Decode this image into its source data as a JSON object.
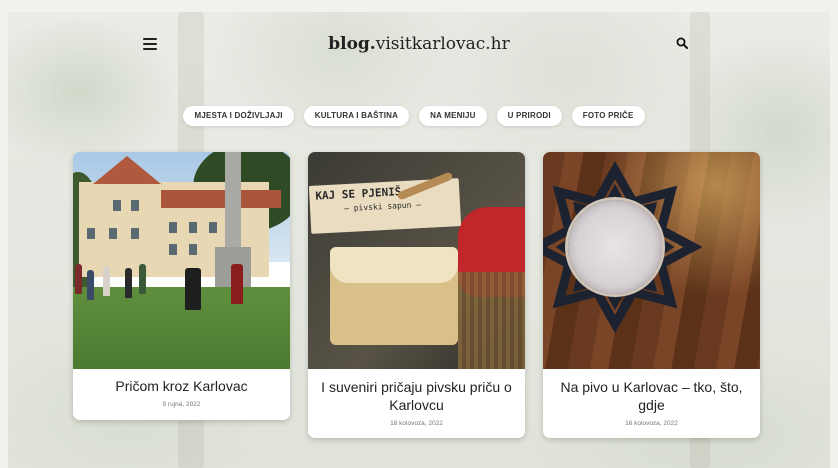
{
  "header": {
    "logo_bold": "blog.",
    "logo_rest": "visitkarlovac.hr",
    "menu_icon": "hamburger-menu-icon",
    "search_icon": "search-icon"
  },
  "categories": [
    {
      "label": "MJESTA I DOŽIVLJAJI"
    },
    {
      "label": "KULTURA I BAŠTINA"
    },
    {
      "label": "NA MENIJU"
    },
    {
      "label": "U PRIRODI"
    },
    {
      "label": "FOTO PRIČE"
    }
  ],
  "posts": [
    {
      "title": "Pričom kroz Karlovac",
      "date": "9 rujna, 2022"
    },
    {
      "title": "I suveniri pričaju pivsku priču o Karlovcu",
      "date": "18 kolovoza, 2022"
    },
    {
      "title": "Na pivo u Karlovac – tko, što, gdje",
      "date": "16 kolovoza, 2022"
    }
  ],
  "images": {
    "post1_sign_text": "",
    "post2_label_line1": "KAJ SE PJENIŠ",
    "post2_label_line2": "– pivski sapun –"
  },
  "colors": {
    "background": "#f2f1ed",
    "card": "#ffffff",
    "text": "#222222"
  }
}
